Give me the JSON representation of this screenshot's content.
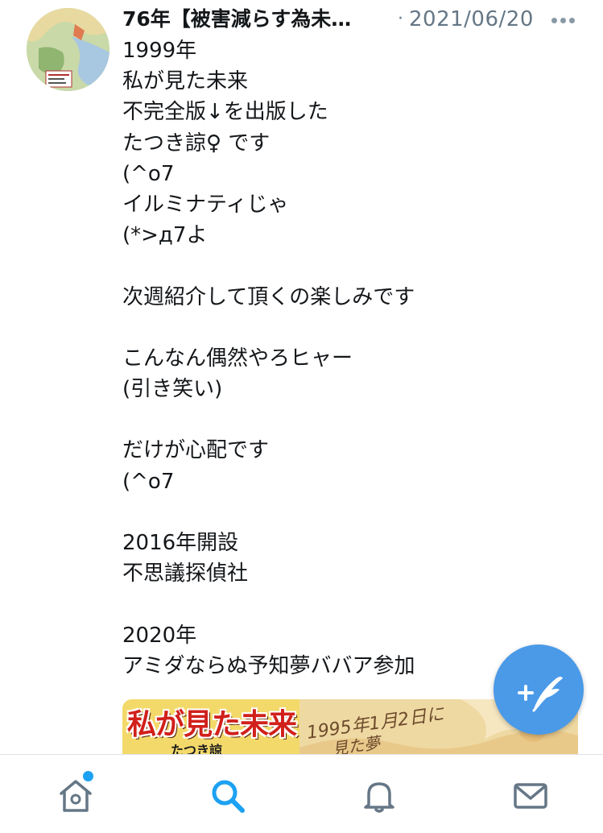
{
  "tweet": {
    "author_name": "76年【被害減らす為未…",
    "separator": "·",
    "timestamp": "2021/06/20",
    "more_icon": "ellipsis-icon",
    "lines": [
      "1999年",
      "私が見た未来",
      "不完全版↓を出版した",
      "たつき諒♀ です",
      "(^o7",
      "イルミナティじゃ",
      "(*>д7よ",
      "",
      "次週紹介して頂くの楽しみです",
      "",
      "こんなん偶然やろヒャー",
      "(引き笑い)",
      "",
      "だけが心配です",
      "(^o7",
      "",
      "2016年開設",
      "不思議探偵社",
      "",
      "2020年",
      "アミダならぬ予知夢ババア参加"
    ]
  },
  "media": {
    "title": "私が見た未来",
    "subtitle": "たつき諒",
    "handwritten_1": "1995年1月2日に",
    "handwritten_2": "見た夢"
  },
  "compose_button": {
    "icon": "compose-tweet-icon",
    "color": "#4a9ae8"
  },
  "tab_bar": {
    "tabs": [
      {
        "icon": "home-icon",
        "active": false,
        "has_notification_dot": true
      },
      {
        "icon": "search-icon",
        "active": true
      },
      {
        "icon": "bell-icon",
        "active": false
      },
      {
        "icon": "mail-icon",
        "active": false
      }
    ],
    "active_color": "#1da1f2",
    "inactive_color": "#657786"
  }
}
